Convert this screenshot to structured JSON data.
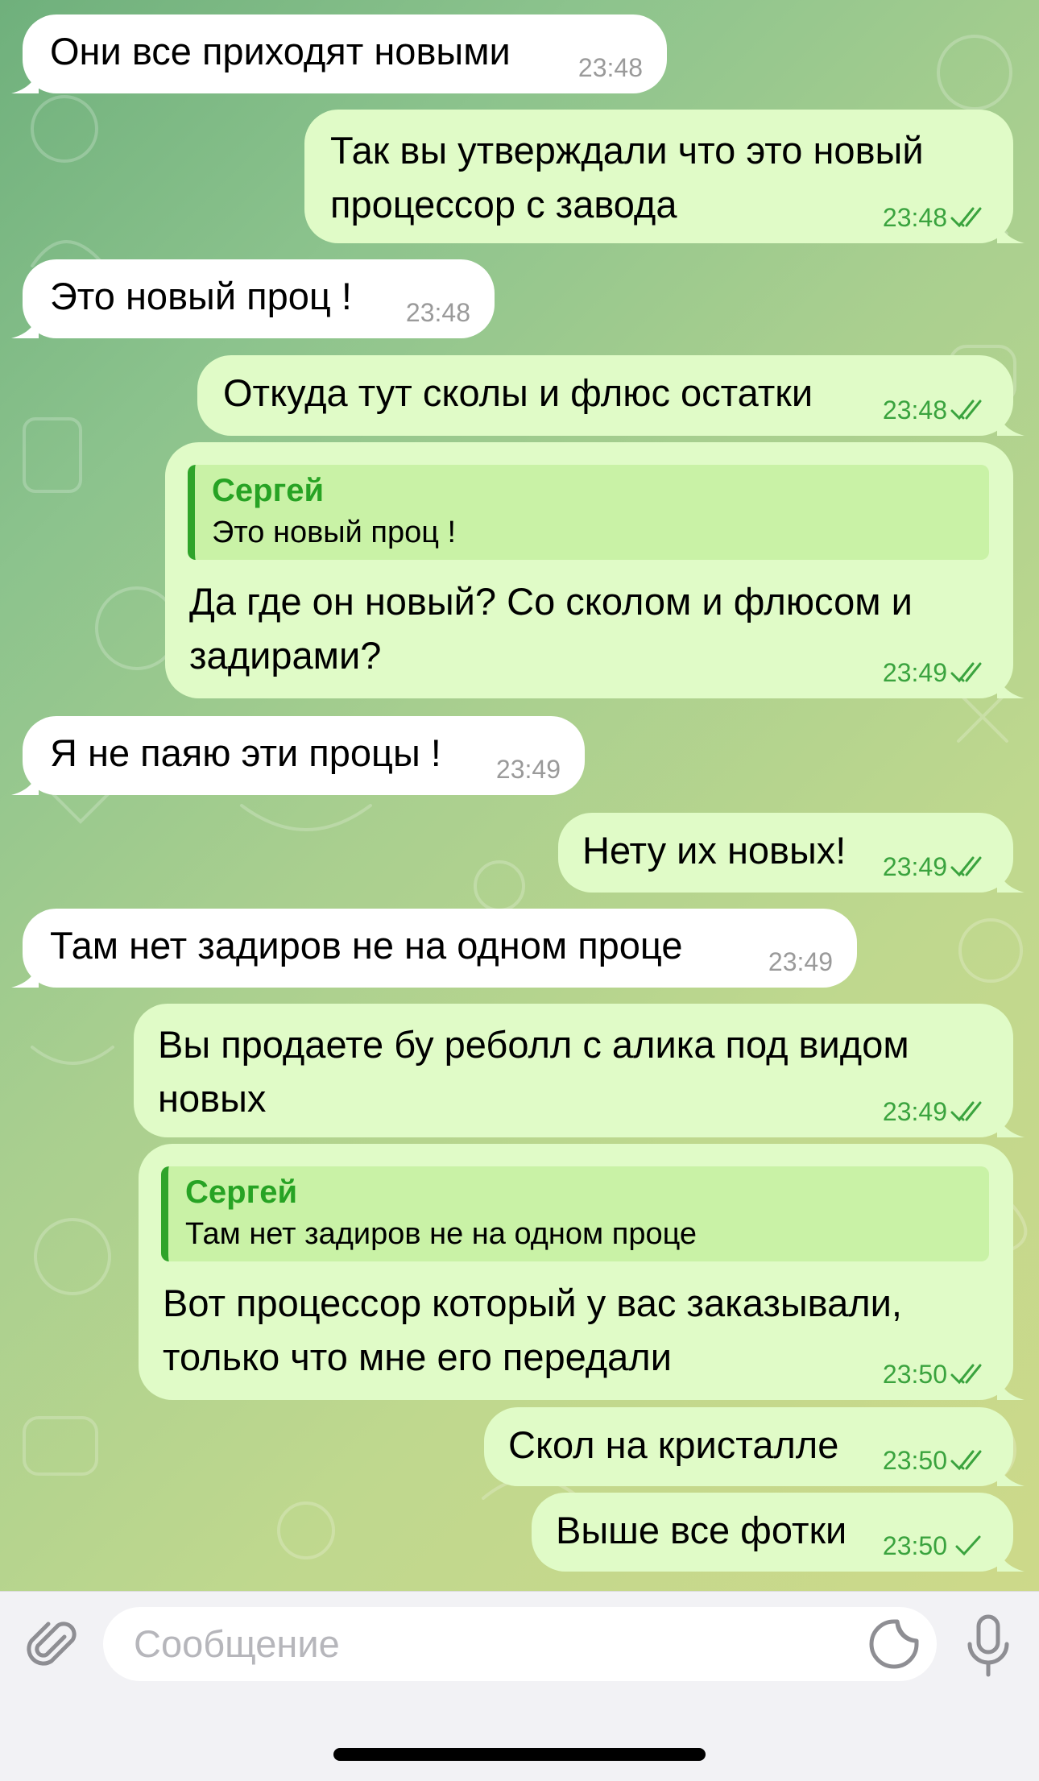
{
  "colors": {
    "incoming_bubble": "#ffffff",
    "outgoing_bubble": "#e0fbc7",
    "outgoing_meta": "#3aa33e",
    "incoming_meta": "#9a9a9a",
    "reply_accent": "#27a324"
  },
  "messages": [
    {
      "direction": "in",
      "text": [
        "Они все приходят новыми"
      ],
      "time": "23:48"
    },
    {
      "direction": "out",
      "text": [
        "Так вы утверждали что это новый",
        "процессор с завода"
      ],
      "time": "23:48",
      "status": "read"
    },
    {
      "direction": "in",
      "text": [
        "Это новый проц !"
      ],
      "time": "23:48"
    },
    {
      "direction": "out",
      "text": [
        "Откуда тут сколы и флюс остатки"
      ],
      "time": "23:48",
      "status": "read"
    },
    {
      "direction": "out",
      "reply": {
        "name": "Сергей",
        "text": "Это новый проц !"
      },
      "text": [
        "Да где он новый? Со сколом и флюсом и",
        "задирами?"
      ],
      "time": "23:49",
      "status": "read"
    },
    {
      "direction": "in",
      "text": [
        "Я не паяю эти процы !"
      ],
      "time": "23:49"
    },
    {
      "direction": "out",
      "text": [
        "Нету их новых!"
      ],
      "time": "23:49",
      "status": "read"
    },
    {
      "direction": "in",
      "text": [
        "Там нет задиров не на одном проце"
      ],
      "time": "23:49"
    },
    {
      "direction": "out",
      "text": [
        "Вы продаете бу реболл с алика под видом",
        "новых"
      ],
      "time": "23:49",
      "status": "read"
    },
    {
      "direction": "out",
      "reply": {
        "name": "Сергей",
        "text": "Там нет задиров не на одном проце"
      },
      "text": [
        "Вот процессор который у вас заказывали,",
        "только что мне его передали"
      ],
      "time": "23:50",
      "status": "read"
    },
    {
      "direction": "out",
      "text": [
        "Скол на кристалле"
      ],
      "time": "23:50",
      "status": "read"
    },
    {
      "direction": "out",
      "text": [
        "Выше все фотки"
      ],
      "time": "23:50",
      "status": "sent"
    }
  ],
  "input": {
    "placeholder": "Сообщение",
    "attach_icon": "paperclip-icon",
    "sticker_icon": "sticker-icon",
    "mic_icon": "microphone-icon"
  }
}
